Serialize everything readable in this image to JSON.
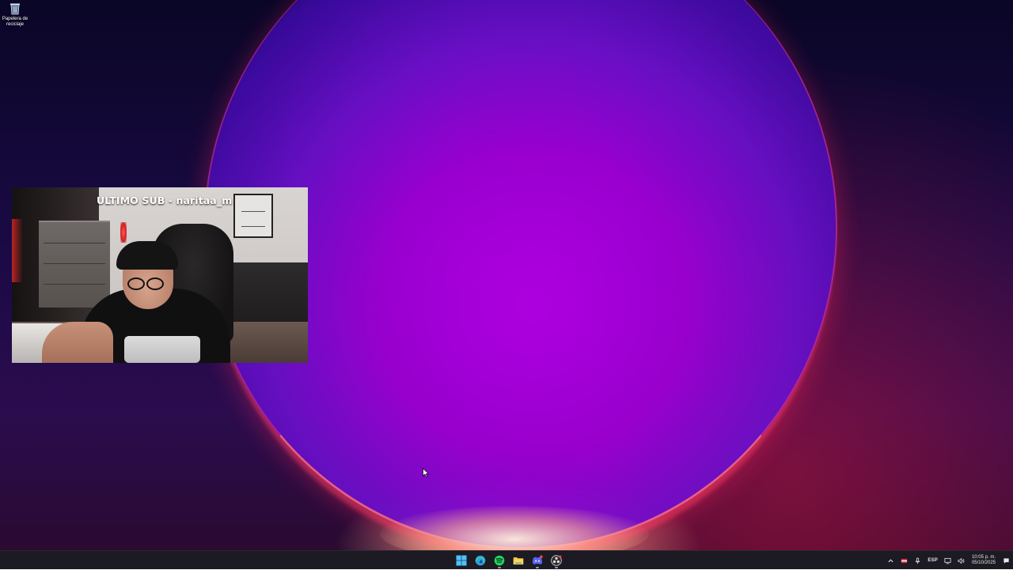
{
  "desktop": {
    "icons": [
      {
        "label": "Papelera de reciclaje",
        "icon": "recycle-bin-icon"
      }
    ]
  },
  "webcam_overlay": {
    "caption": "ULTIMO SUB - naritaa_m"
  },
  "taskbar": {
    "apps": [
      {
        "name": "start",
        "icon": "windows-start-icon",
        "color": "#4cc2ff",
        "running": false
      },
      {
        "name": "edge",
        "icon": "edge-browser-icon",
        "color": "#2f9be6",
        "running": false
      },
      {
        "name": "spotify",
        "icon": "spotify-icon",
        "color": "#1ed760",
        "running": true
      },
      {
        "name": "file-explorer",
        "icon": "folder-icon",
        "color": "#f4c33a",
        "running": false
      },
      {
        "name": "discord",
        "icon": "discord-icon",
        "color": "#5865f2",
        "running": true
      },
      {
        "name": "obs",
        "icon": "obs-studio-icon",
        "color": "#d8d8d8",
        "running": true
      }
    ],
    "tray": {
      "language": "ESP",
      "time": "10:05 p. m.",
      "date": "05/10/2025",
      "icons": [
        "chevron-up-icon",
        "flag-app-icon",
        "microphone-icon",
        "network-icon",
        "volume-icon",
        "notification-icon"
      ]
    }
  }
}
